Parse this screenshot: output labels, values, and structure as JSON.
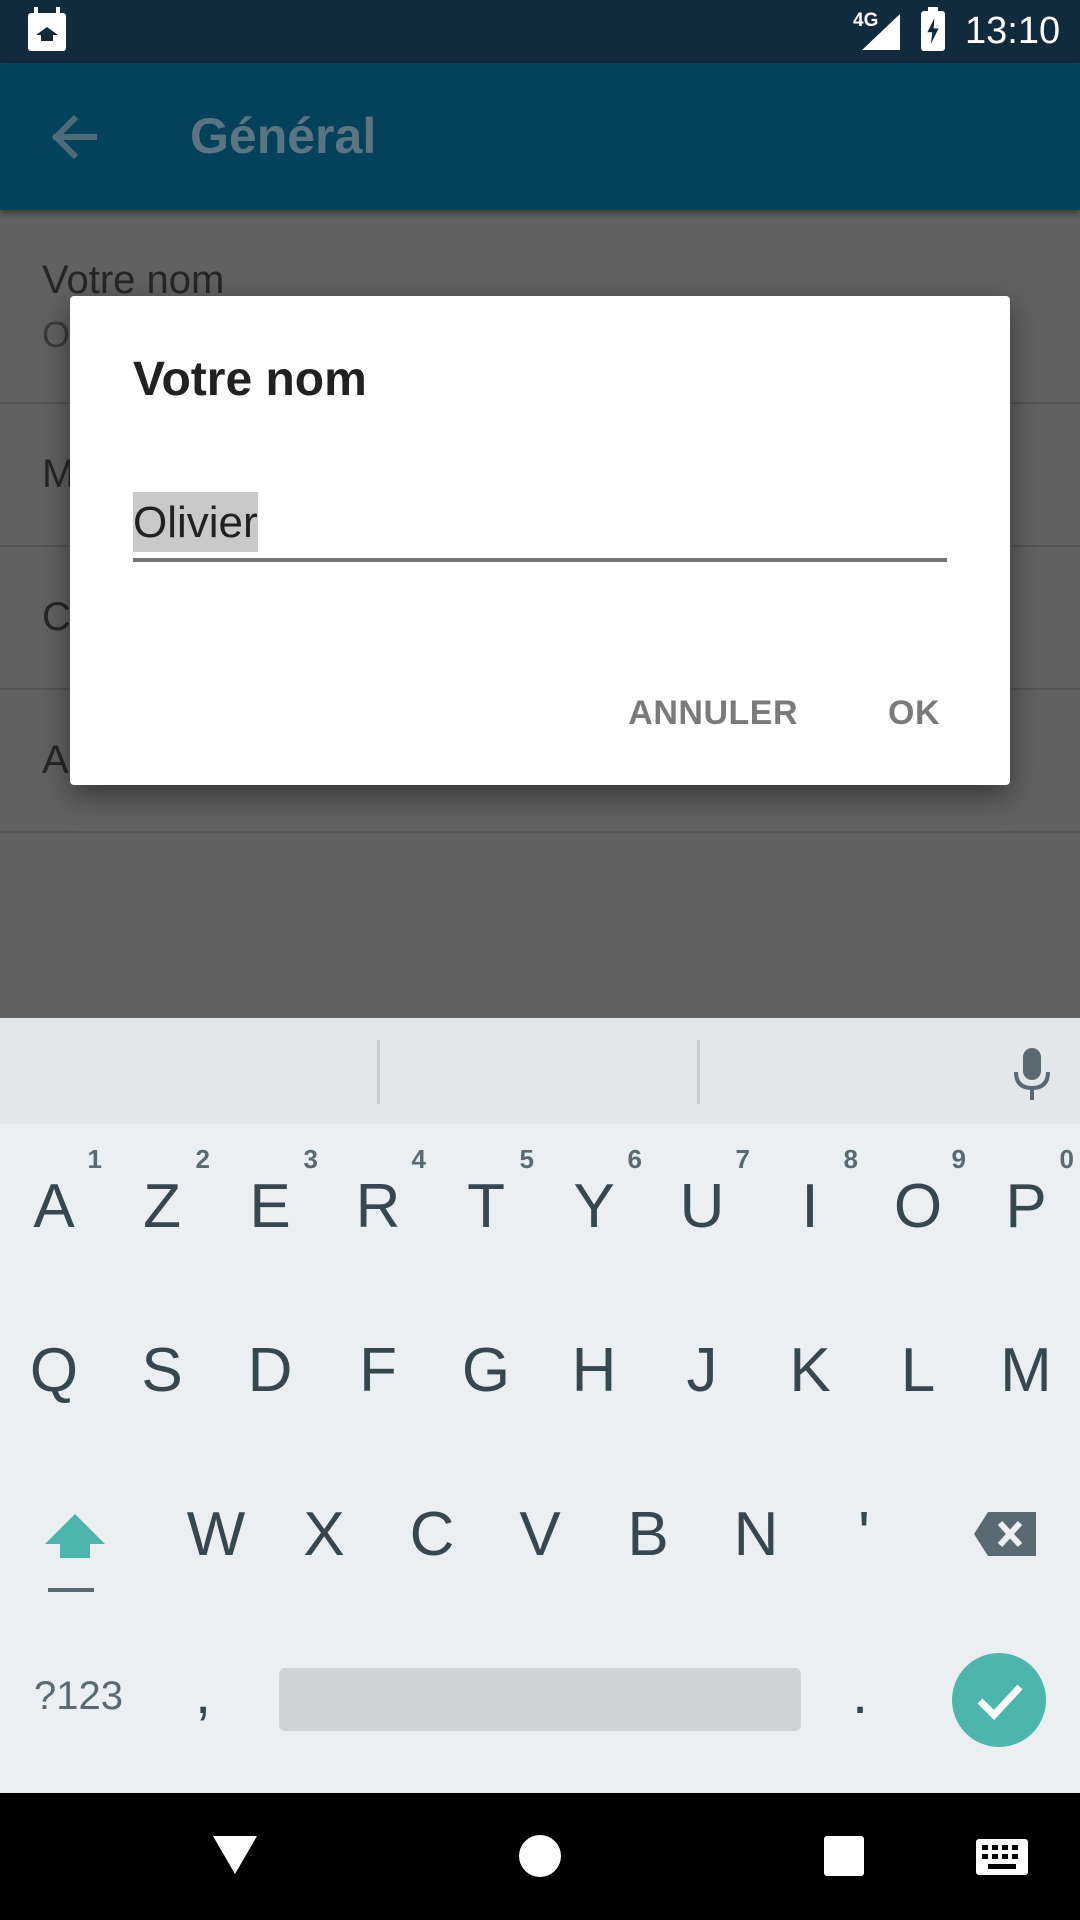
{
  "status_bar": {
    "network": "4G",
    "time": "13:10"
  },
  "app_bar": {
    "title": "Général"
  },
  "settings": [
    {
      "title": "Votre nom",
      "subtitle": "O"
    },
    {
      "title": "M"
    },
    {
      "title": "C"
    },
    {
      "title": "A"
    }
  ],
  "dialog": {
    "title": "Votre nom",
    "input_value": "Olivier",
    "cancel_label": "ANNULER",
    "ok_label": "OK"
  },
  "keyboard": {
    "row1": [
      {
        "key": "A",
        "num": "1"
      },
      {
        "key": "Z",
        "num": "2"
      },
      {
        "key": "E",
        "num": "3"
      },
      {
        "key": "R",
        "num": "4"
      },
      {
        "key": "T",
        "num": "5"
      },
      {
        "key": "Y",
        "num": "6"
      },
      {
        "key": "U",
        "num": "7"
      },
      {
        "key": "I",
        "num": "8"
      },
      {
        "key": "O",
        "num": "9"
      },
      {
        "key": "P",
        "num": "0"
      }
    ],
    "row2": [
      "Q",
      "S",
      "D",
      "F",
      "G",
      "H",
      "J",
      "K",
      "L",
      "M"
    ],
    "row3": [
      "W",
      "X",
      "C",
      "V",
      "B",
      "N",
      "'"
    ],
    "symbols_label": "?123",
    "comma": ",",
    "period": "."
  },
  "icons": {
    "app_notification": "calendar-graduation-icon",
    "back": "arrow-left-icon",
    "mic": "microphone-icon",
    "shift": "shift-icon",
    "backspace": "backspace-icon",
    "enter": "checkmark-icon"
  },
  "colors": {
    "status_bar": "#112a3c",
    "app_bar": "#04415a",
    "accent": "#4db6ac"
  }
}
